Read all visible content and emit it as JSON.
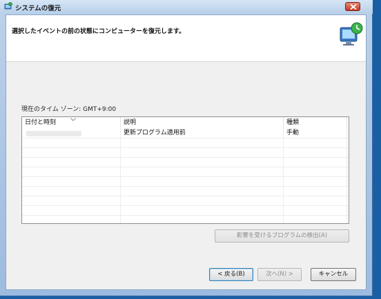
{
  "window": {
    "title": "システムの復元",
    "instruction": "選択したイベントの前の状態にコンピューターを復元します。",
    "icons": [
      "system-restore-icon",
      "close-icon",
      "monitor-restore-icon"
    ]
  },
  "timezone": {
    "label": "現在のタイム ゾーン: GMT+9:00"
  },
  "table": {
    "columns": [
      "日付と時刻",
      "説明",
      "種類"
    ],
    "sorted_column": "日付と時刻",
    "rows": [
      {
        "datetime": "",
        "description": "更新プログラム適用前",
        "type": "手動"
      }
    ]
  },
  "buttons": {
    "scan_affected": "影響を受けるプログラムの検出(A)",
    "back": "< 戻る(B)",
    "next": "次へ(N) >",
    "cancel": "キャンセル"
  },
  "colors": {
    "desktop": "#1a5fa3",
    "frame": "#bcd2ea",
    "close_red": "#c43b25"
  }
}
